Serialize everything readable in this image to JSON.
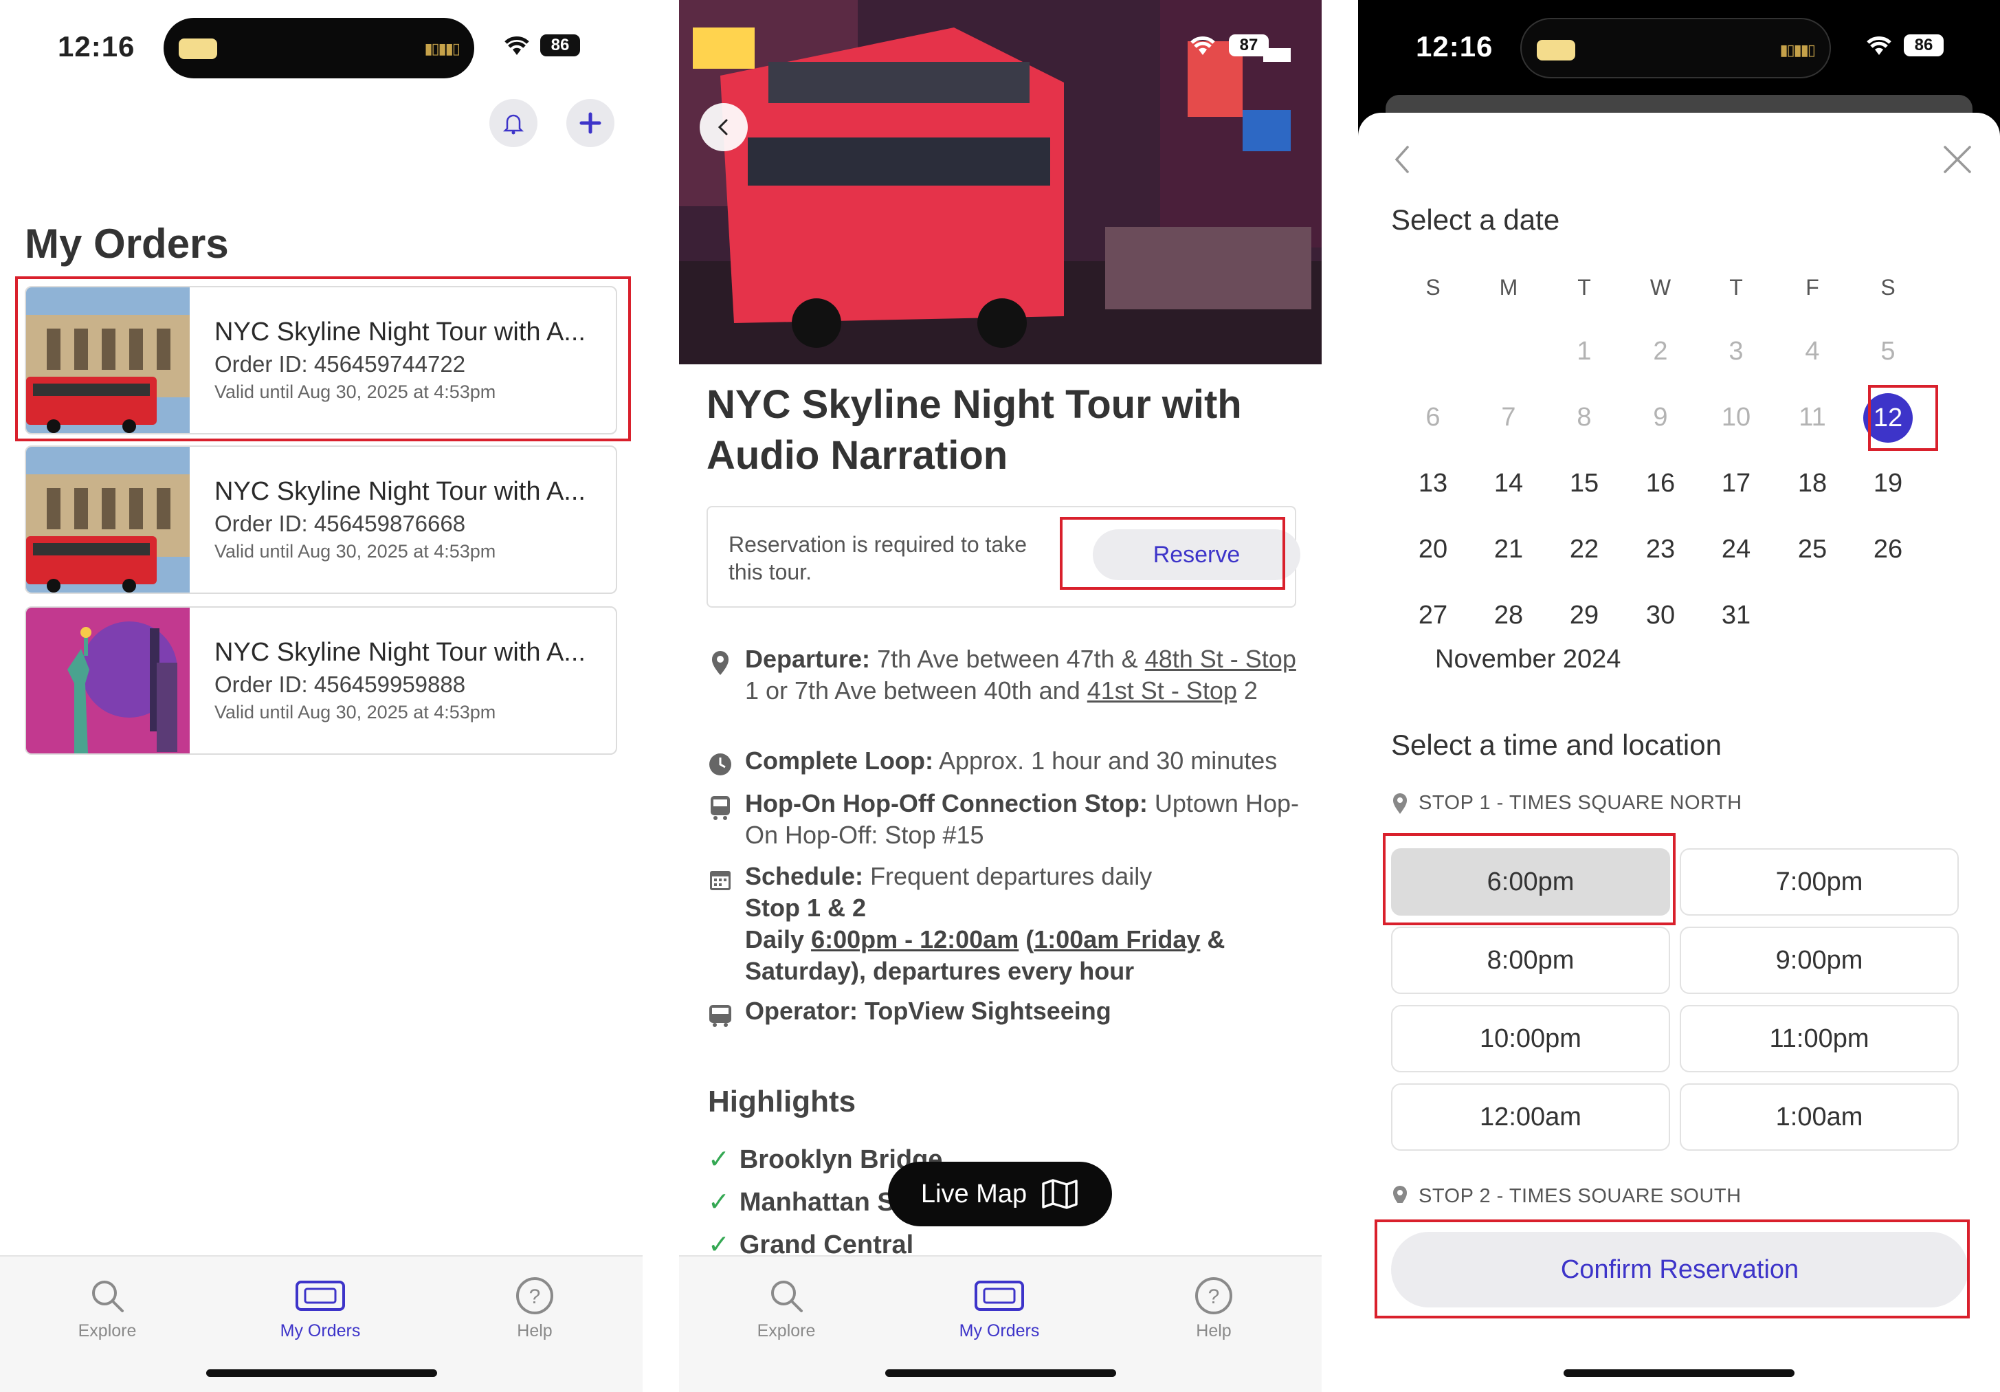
{
  "status": {
    "time": "12:16",
    "battery_1": "86",
    "battery_2": "87",
    "battery_3": "86"
  },
  "orders_screen": {
    "title": "My Orders",
    "orders": [
      {
        "name": "NYC Skyline Night Tour with A...",
        "order_id": "Order ID: 456459744722",
        "valid": "Valid until Aug 30, 2025 at 4:53pm"
      },
      {
        "name": "NYC Skyline Night Tour with A...",
        "order_id": "Order ID: 456459876668",
        "valid": "Valid until Aug 30, 2025 at 4:53pm"
      },
      {
        "name": "NYC Skyline Night Tour with A...",
        "order_id": "Order ID: 456459959888",
        "valid": "Valid until Aug 30, 2025 at 4:53pm"
      }
    ]
  },
  "tabs": {
    "explore": "Explore",
    "orders": "My Orders",
    "help": "Help"
  },
  "detail_screen": {
    "title": "NYC Skyline Night Tour with Audio Narration",
    "reservation_msg": "Reservation is required to take this tour.",
    "reserve_label": "Reserve",
    "departure_label": "Departure:",
    "departure_text_a": "7th Ave between 47th &",
    "departure_link_a": "48th St - Stop",
    "departure_text_b": "1 or 7th Ave between 40th and",
    "departure_link_b": "41st St - Stop",
    "departure_text_c": "2",
    "loop_label": "Complete Loop:",
    "loop_text": "Approx. 1 hour and 30 minutes",
    "hoho_label": "Hop-On Hop-Off Connection Stop:",
    "hoho_text": "Uptown Hop-On Hop-Off: Stop #15",
    "schedule_label": "Schedule:",
    "schedule_text": "Frequent departures daily",
    "schedule_stops": "Stop 1 & 2",
    "schedule_daily_a": "Daily",
    "schedule_daily_link": "6:00pm - 12:00am",
    "schedule_daily_b": "(",
    "schedule_daily_link2": "1:00am Friday",
    "schedule_daily_c": "& Saturday), departures every hour",
    "operator_label": "Operator: TopView Sightseeing",
    "highlights_title": "Highlights",
    "highlights": [
      "Brooklyn Bridge",
      "Manhattan S",
      "Grand Central"
    ],
    "live_map_label": "Live Map"
  },
  "reserve_screen": {
    "select_date": "Select a date",
    "weekdays": [
      "S",
      "M",
      "T",
      "W",
      "T",
      "F",
      "S"
    ],
    "month": "November 2024",
    "selected_day": "12",
    "select_time": "Select a time and location",
    "stop1": "STOP 1 - TIMES SQUARE NORTH",
    "stop2": "STOP 2 - TIMES SQUARE SOUTH",
    "times": [
      "6:00pm",
      "7:00pm",
      "8:00pm",
      "9:00pm",
      "10:00pm",
      "11:00pm",
      "12:00am",
      "1:00am"
    ],
    "selected_time": "6:00pm",
    "confirm_label": "Confirm Reservation"
  },
  "colors": {
    "accent": "#3d34c9",
    "highlight_box": "#d9202c",
    "check": "#34a853"
  }
}
